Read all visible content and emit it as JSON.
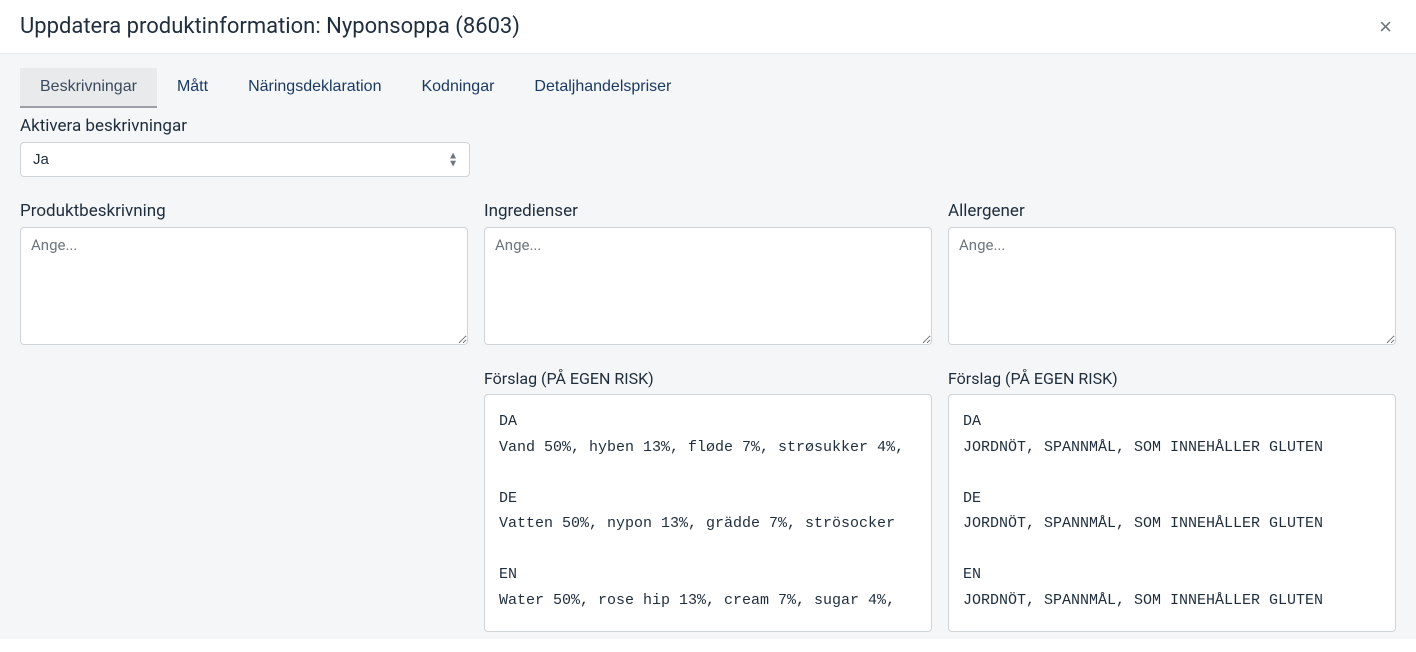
{
  "header": {
    "title": "Uppdatera produktinformation: Nyponsoppa (8603)",
    "close": "×"
  },
  "tabs": [
    {
      "label": "Beskrivningar",
      "active": true
    },
    {
      "label": "Mått",
      "active": false
    },
    {
      "label": "Näringsdeklaration",
      "active": false
    },
    {
      "label": "Kodningar",
      "active": false
    },
    {
      "label": "Detaljhandelspriser",
      "active": false
    }
  ],
  "activate": {
    "label": "Aktivera beskrivningar",
    "value": "Ja"
  },
  "columns": {
    "product_description": {
      "label": "Produktbeskrivning",
      "placeholder": "Ange..."
    },
    "ingredients": {
      "label": "Ingredienser",
      "placeholder": "Ange...",
      "suggestion_label": "Förslag (PÅ EGEN RISK)",
      "suggestions": [
        {
          "lang": "DA",
          "text": "Vand 50%, hyben 13%, fløde 7%, strøsukker 4%,"
        },
        {
          "lang": "DE",
          "text": "Vatten 50%, nypon 13%, grädde 7%, strösocker"
        },
        {
          "lang": "EN",
          "text": "Water 50%, rose hip 13%, cream 7%, sugar 4%,"
        }
      ]
    },
    "allergens": {
      "label": "Allergener",
      "placeholder": "Ange...",
      "suggestion_label": "Förslag (PÅ EGEN RISK)",
      "suggestions": [
        {
          "lang": "DA",
          "text": "JORDNÖT, SPANNMÅL, SOM INNEHÅLLER GLUTEN"
        },
        {
          "lang": "DE",
          "text": "JORDNÖT, SPANNMÅL, SOM INNEHÅLLER GLUTEN"
        },
        {
          "lang": "EN",
          "text": "JORDNÖT, SPANNMÅL, SOM INNEHÅLLER GLUTEN"
        }
      ]
    }
  }
}
